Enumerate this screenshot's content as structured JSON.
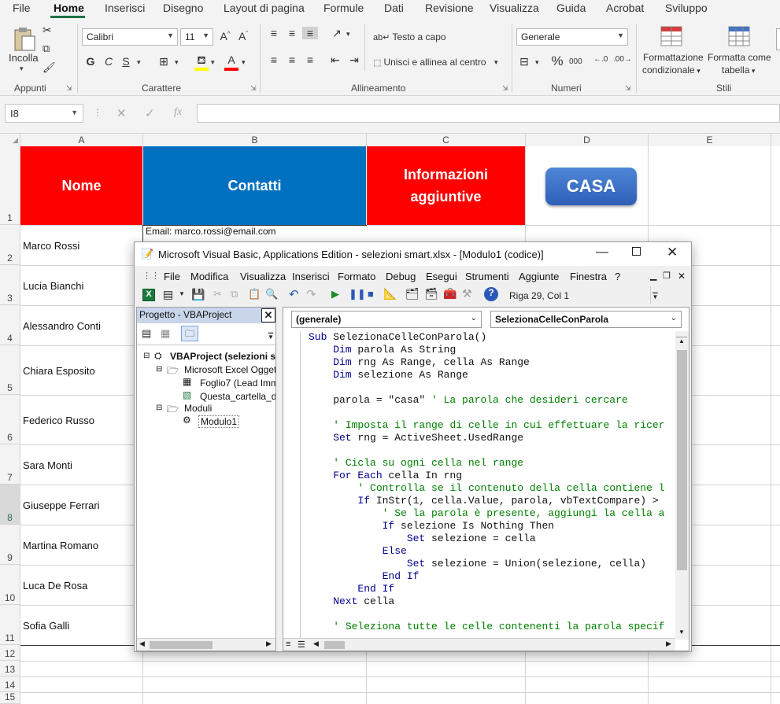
{
  "ribbon": {
    "tabs": [
      "File",
      "Home",
      "Inserisci",
      "Disegno",
      "Layout di pagina",
      "Formule",
      "Dati",
      "Revisione",
      "Visualizza",
      "Guida",
      "Acrobat",
      "Sviluppo"
    ],
    "clipboard": {
      "paste": "Incolla",
      "group": "Appunti"
    },
    "font": {
      "name": "Calibri",
      "size": "11",
      "bold": "G",
      "italic": "C",
      "underline": "S",
      "group": "Carattere"
    },
    "alignment": {
      "wrap": "Testo a capo",
      "merge": "Unisci e allinea al centro",
      "group": "Allineamento"
    },
    "number": {
      "format": "Generale",
      "percent": "%",
      "thousands": "000",
      "group": "Numeri"
    },
    "styles": {
      "conditional1": "Formattazione",
      "conditional2": "condizionale",
      "table1": "Formatta come",
      "table2": "tabella",
      "group": "Stili"
    }
  },
  "formula_bar": {
    "name_box": "I8",
    "fx": "fx"
  },
  "sheet": {
    "columns": [
      "A",
      "B",
      "C",
      "D",
      "E"
    ],
    "rows": [
      "1",
      "2",
      "3",
      "4",
      "5",
      "6",
      "7",
      "8",
      "9",
      "10",
      "11",
      "12",
      "13",
      "14",
      "15"
    ],
    "headers": {
      "a": "Nome",
      "b": "Contatti",
      "c": "Informazioni aggiuntive"
    },
    "header_colors": {
      "nome": "#ff0000",
      "contatti": "#0070c0",
      "info": "#ff0000"
    },
    "names": [
      "Marco Rossi",
      "Lucia Bianchi",
      "Alessandro Conti",
      "Chiara Esposito",
      "Federico Russo",
      "Sara Monti",
      "Giuseppe Ferrari",
      "Martina Romano",
      "Luca De Rosa",
      "Sofia Galli"
    ],
    "b2": "Email: marco.rossi@email.com",
    "button": "CASA"
  },
  "vba": {
    "title": "Microsoft Visual Basic, Applications Edition - selezioni smart.xlsx - [Modulo1 (codice)]",
    "menu": [
      "File",
      "Modifica",
      "Visualizza",
      "Inserisci",
      "Formato",
      "Debug",
      "Esegui",
      "Strumenti",
      "Aggiunte",
      "Finestra",
      "?"
    ],
    "position": "Riga 29, Col 1",
    "project_title": "Progetto - VBAProject",
    "tree": {
      "root": "VBAProject (selezioni sm",
      "objects": "Microsoft Excel Oggetti",
      "sheet": "Foglio7 (Lead Immob",
      "workbook": "Questa_cartella_di_",
      "modules": "Moduli",
      "module1": "Modulo1"
    },
    "combo_left": "(generale)",
    "combo_right": "SelezionaCelleConParola",
    "code": [
      {
        "k": "Sub ",
        "t": "SelezionaCelleConParola()",
        "c": ""
      },
      {
        "k": "    Dim ",
        "t": "parola As String",
        "c": ""
      },
      {
        "k": "    Dim ",
        "t": "rng As Range, cella As Range",
        "c": ""
      },
      {
        "k": "    Dim ",
        "t": "selezione As Range",
        "c": ""
      },
      {
        "k": "",
        "t": "",
        "c": ""
      },
      {
        "k": "",
        "t": "    parola = \"casa\" ",
        "c": "' La parola che desideri cercare"
      },
      {
        "k": "",
        "t": "",
        "c": ""
      },
      {
        "k": "",
        "t": "    ",
        "c": "' Imposta il range di celle in cui effettuare la ricer"
      },
      {
        "k": "    Set ",
        "t": "rng = ActiveSheet.UsedRange",
        "c": ""
      },
      {
        "k": "",
        "t": "",
        "c": ""
      },
      {
        "k": "",
        "t": "    ",
        "c": "' Cicla su ogni cella nel range"
      },
      {
        "k": "    For Each ",
        "t": "cella In rng",
        "c": ""
      },
      {
        "k": "",
        "t": "        ",
        "c": "' Controlla se il contenuto della cella contiene l"
      },
      {
        "k": "        If ",
        "t": "InStr(1, cella.Value, parola, vbTextCompare) >",
        "c": ""
      },
      {
        "k": "",
        "t": "            ",
        "c": "' Se la parola è presente, aggiungi la cella a"
      },
      {
        "k": "            If ",
        "t": "selezione Is Nothing Then",
        "c": ""
      },
      {
        "k": "                Set ",
        "t": "selezione = cella",
        "c": ""
      },
      {
        "k": "            Else",
        "t": "",
        "c": ""
      },
      {
        "k": "                Set ",
        "t": "selezione = Union(selezione, cella)",
        "c": ""
      },
      {
        "k": "            End If",
        "t": "",
        "c": ""
      },
      {
        "k": "        End If",
        "t": "",
        "c": ""
      },
      {
        "k": "    Next ",
        "t": "cella",
        "c": ""
      },
      {
        "k": "",
        "t": "",
        "c": ""
      },
      {
        "k": "",
        "t": "    ",
        "c": "' Seleziona tutte le celle contenenti la parola specif"
      }
    ]
  }
}
